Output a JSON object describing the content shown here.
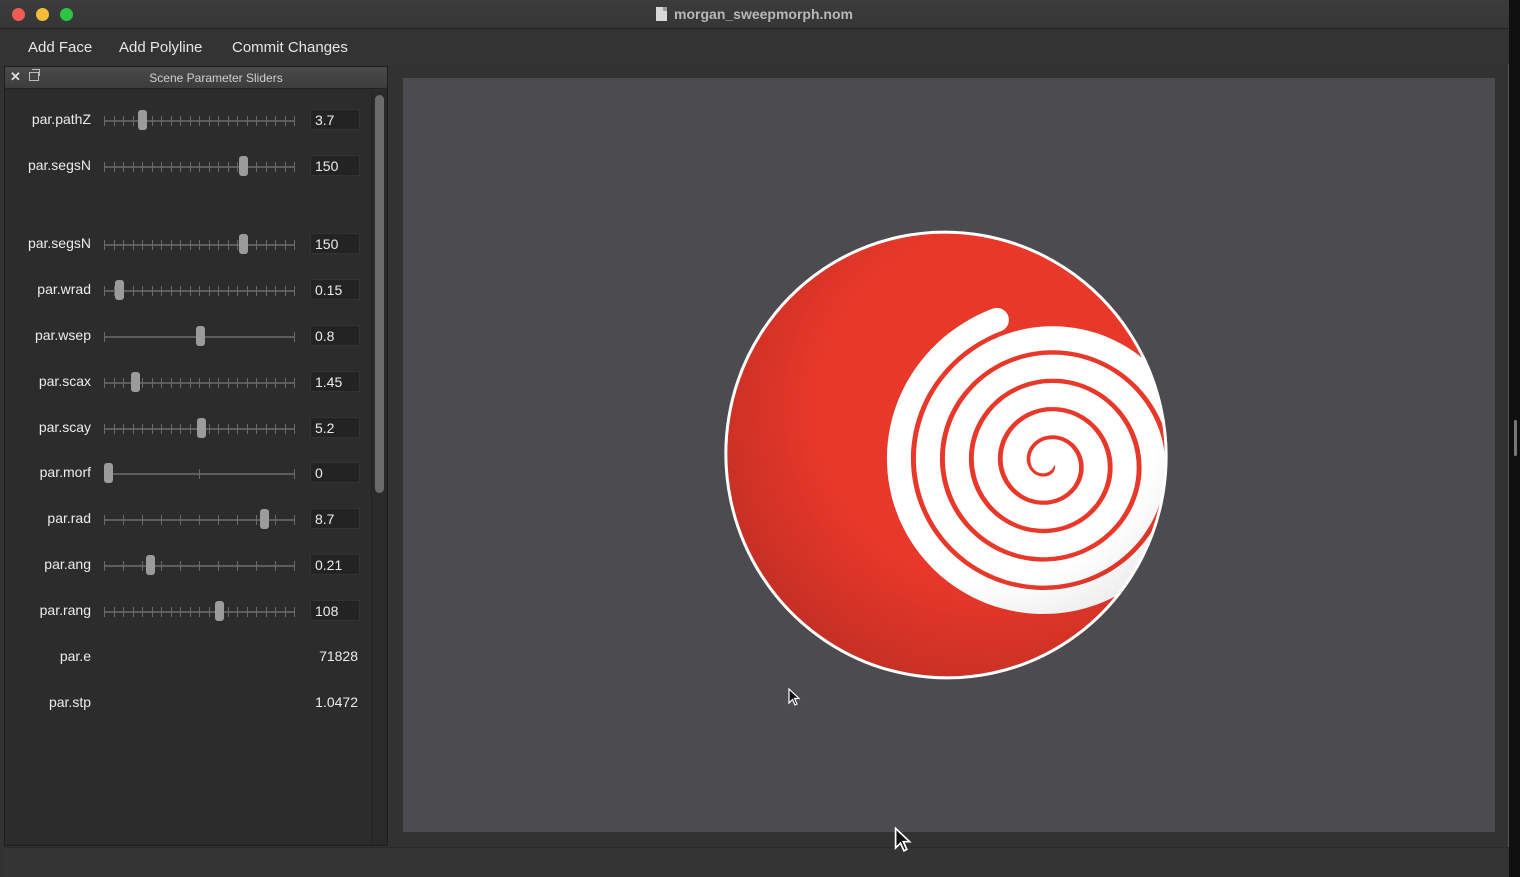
{
  "window": {
    "title": "morgan_sweepmorph.nom"
  },
  "menu": {
    "items": [
      "Add Face",
      "Add Polyline",
      "Commit Changes"
    ]
  },
  "panel": {
    "title": "Scene Parameter Sliders",
    "params": [
      {
        "label": "par.pathZ",
        "value": "3.7",
        "slider": true,
        "pos": 0.2,
        "ticks": 21
      },
      {
        "label": "par.segsN",
        "value": "150",
        "slider": true,
        "pos": 0.73,
        "ticks": 21
      },
      {
        "label": "par.segsN",
        "value": "150",
        "slider": true,
        "pos": 0.73,
        "ticks": 21
      },
      {
        "label": "par.wrad",
        "value": "0.15",
        "slider": true,
        "pos": 0.08,
        "ticks": 21
      },
      {
        "label": "par.wsep",
        "value": "0.8",
        "slider": true,
        "pos": 0.5,
        "ticks": 2
      },
      {
        "label": "par.scax",
        "value": "1.45",
        "slider": true,
        "pos": 0.16,
        "ticks": 21
      },
      {
        "label": "par.scay",
        "value": "5.2",
        "slider": true,
        "pos": 0.51,
        "ticks": 21
      },
      {
        "label": "par.morf",
        "value": "0",
        "slider": true,
        "pos": 0.02,
        "ticks": 3
      },
      {
        "label": "par.rad",
        "value": "8.7",
        "slider": true,
        "pos": 0.84,
        "ticks": 11
      },
      {
        "label": "par.ang",
        "value": "0.21",
        "slider": true,
        "pos": 0.24,
        "ticks": 11
      },
      {
        "label": "par.rang",
        "value": "108",
        "slider": true,
        "pos": 0.6,
        "ticks": 21
      },
      {
        "label": "par.e",
        "value": "71828",
        "slider": false
      },
      {
        "label": "par.stp",
        "value": "1.0472",
        "slider": false
      }
    ]
  },
  "colors": {
    "stripe_red": "#e8382a",
    "stripe_white": "#ffffff",
    "viewport_bg": "#4c4b50"
  },
  "icons": {
    "close": "close-icon",
    "float": "float-window-icon",
    "document": "document-icon",
    "cursor": "mouse-pointer-icon"
  }
}
